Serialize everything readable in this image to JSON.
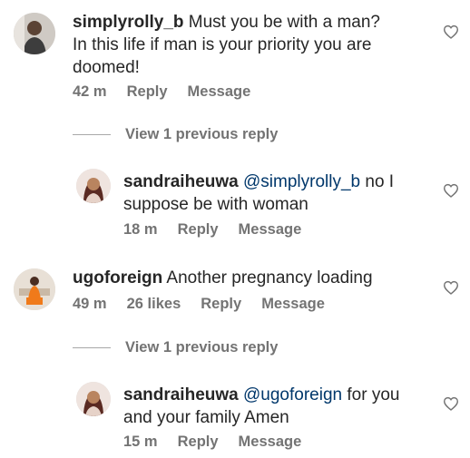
{
  "comments": [
    {
      "username": "simplyrolly_b",
      "mention": "",
      "text_line1": " Must you be with a man?",
      "text_line2": "In this life if man is your priority you are",
      "text_line3": "doomed!",
      "time": "42 m",
      "likes": "",
      "reply": "Reply",
      "message": "Message"
    },
    {
      "username": "sandraiheuwa",
      "mention": "@simplyrolly_b",
      "text_line1": " no I",
      "text_line2": "suppose be with woman",
      "time": "18 m",
      "reply": "Reply",
      "message": "Message"
    },
    {
      "username": "ugoforeign",
      "mention": "",
      "text_line1": " Another pregnancy loading",
      "time": "49 m",
      "likes": "26 likes",
      "reply": "Reply",
      "message": "Message"
    },
    {
      "username": "sandraiheuwa",
      "mention": "@ugoforeign",
      "text_line1": " for you",
      "text_line2": "and your family Amen",
      "time": "15 m",
      "reply": "Reply",
      "message": "Message"
    }
  ],
  "view_previous": [
    "View 1 previous reply",
    "View 1 previous reply"
  ],
  "icons": {
    "like": "heart-outline-icon"
  },
  "colors": {
    "text": "#262626",
    "muted": "#737373",
    "mention": "#00376b"
  }
}
